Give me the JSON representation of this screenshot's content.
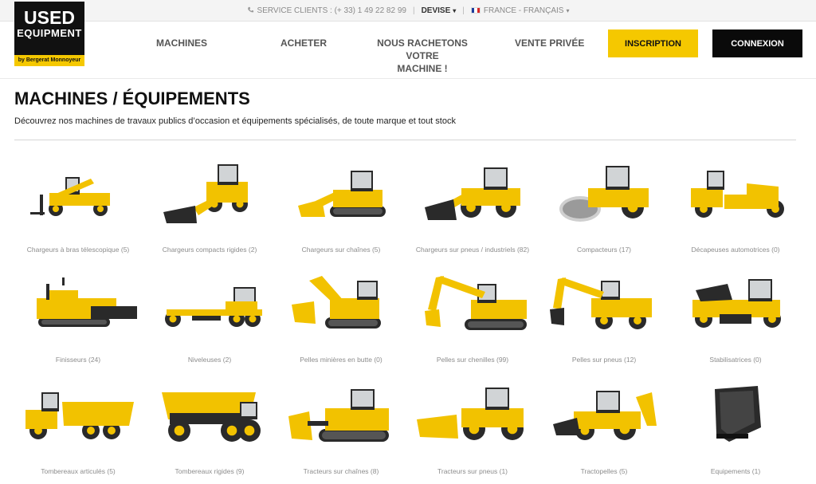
{
  "topbar": {
    "service_label": "SERVICE CLIENTS : (+ 33) 1 49 22 82 99",
    "devise_label": "DEVISE",
    "locale_label": "FRANCE - FRANÇAIS"
  },
  "logo": {
    "line1": "USED",
    "line2": "EQUIPMENT",
    "tagline": "by Bergerat Monnoyeur"
  },
  "nav": {
    "machines": "MACHINES",
    "acheter": "ACHETER",
    "rachat_line1": "NOUS RACHETONS VOTRE",
    "rachat_line2": "MACHINE !",
    "vente": "VENTE PRIVÉE",
    "inscription": "INSCRIPTION",
    "connexion": "CONNEXION"
  },
  "colors": {
    "accent": "#f5c800",
    "dark": "#0a0a0a",
    "machine": "#f2c200"
  },
  "page": {
    "title": "MACHINES / ÉQUIPEMENTS",
    "subtitle": "Découvrez nos machines de travaux publics d’occasion et équipements spécialisés, de toute marque et tout stock"
  },
  "categories": [
    {
      "label": "Chargeurs à bras télescopique (5)",
      "icon": "telehandler-icon"
    },
    {
      "label": "Chargeurs compacts rigides (2)",
      "icon": "skid-steer-icon"
    },
    {
      "label": "Chargeurs sur chaînes (5)",
      "icon": "track-loader-icon"
    },
    {
      "label": "Chargeurs sur pneus / industriels (82)",
      "icon": "wheel-loader-icon"
    },
    {
      "label": "Compacteurs (17)",
      "icon": "compactor-icon"
    },
    {
      "label": "Décapeuses automotrices (0)",
      "icon": "scraper-icon"
    },
    {
      "label": "Finisseurs (24)",
      "icon": "paver-icon"
    },
    {
      "label": "Niveleuses (2)",
      "icon": "grader-icon"
    },
    {
      "label": "Pelles minières en butte (0)",
      "icon": "mining-shovel-icon"
    },
    {
      "label": "Pelles sur chenilles (99)",
      "icon": "crawler-excavator-icon"
    },
    {
      "label": "Pelles sur pneus (12)",
      "icon": "wheeled-excavator-icon"
    },
    {
      "label": "Stabilisatrices (0)",
      "icon": "stabilizer-icon"
    },
    {
      "label": "Tombereaux articulés (5)",
      "icon": "articulated-truck-icon"
    },
    {
      "label": "Tombereaux rigides (9)",
      "icon": "rigid-truck-icon"
    },
    {
      "label": "Tracteurs sur chaînes (8)",
      "icon": "dozer-icon"
    },
    {
      "label": "Tracteurs sur pneus (1)",
      "icon": "wheel-dozer-icon"
    },
    {
      "label": "Tractopelles (5)",
      "icon": "backhoe-icon"
    },
    {
      "label": "Equipements (1)",
      "icon": "bucket-icon"
    }
  ]
}
